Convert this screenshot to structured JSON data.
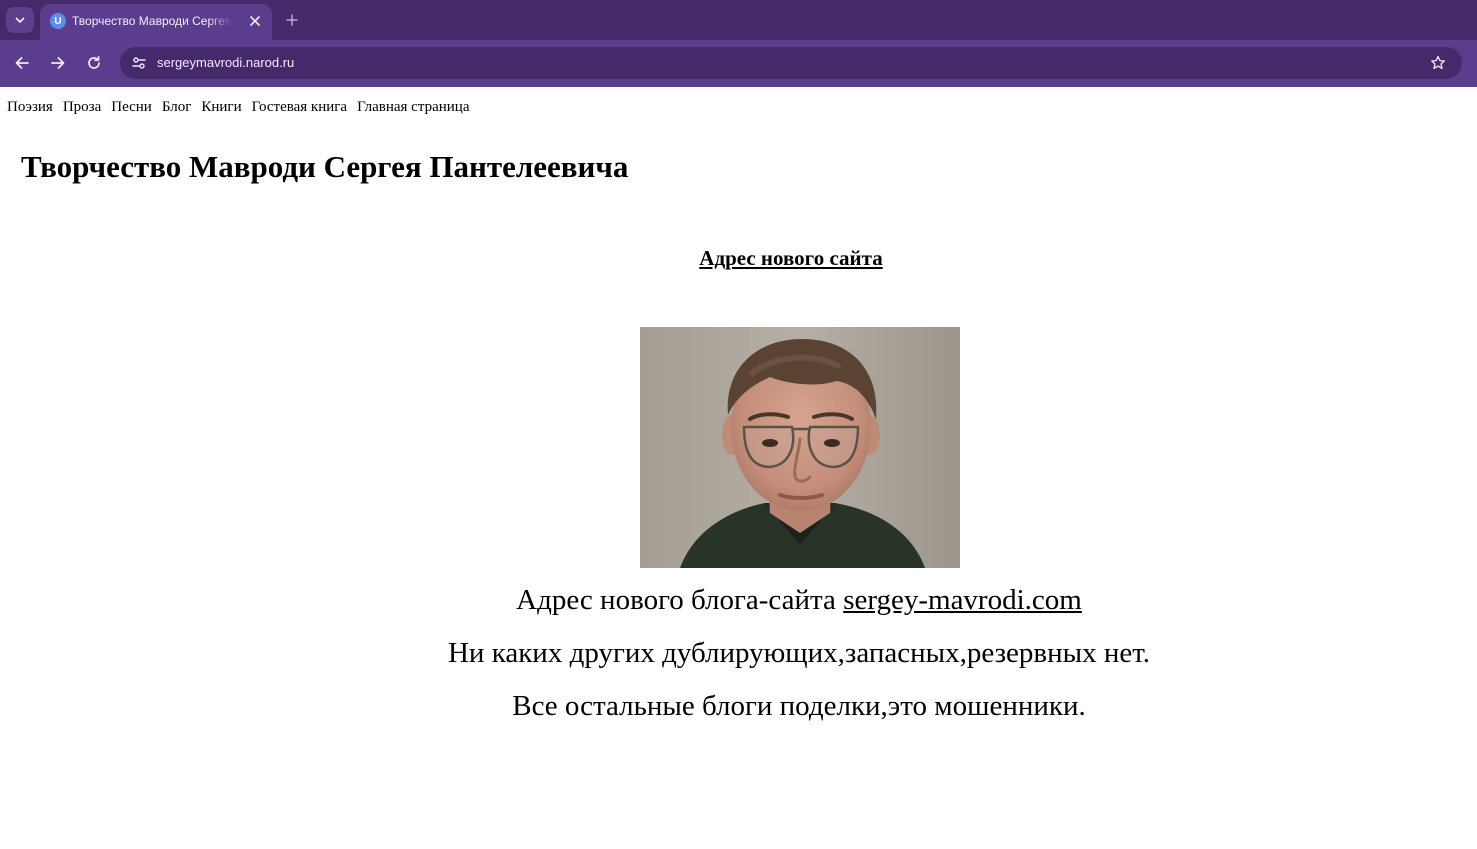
{
  "browser": {
    "tab_title": "Творчество Мавроди Сергея Пантелеевича",
    "favicon_letter": "U",
    "url": "sergeymavrodi.narod.ru",
    "colors": {
      "frame": "#452a6b",
      "toolbar": "#5b3d8e"
    }
  },
  "site_nav": {
    "items": [
      {
        "label": "Поэзия"
      },
      {
        "label": "Проза"
      },
      {
        "label": "Песни"
      },
      {
        "label": "Блог"
      },
      {
        "label": "Книги"
      },
      {
        "label": "Гостевая книга"
      },
      {
        "label": "Главная страница"
      }
    ]
  },
  "page": {
    "title": "Творчество Мавроди Сергея Пантелеевича",
    "new_site_heading": "Адрес нового сайта",
    "photo": "portrait-photo",
    "line1_prefix": "Адрес нового блога-сайта ",
    "line1_link": "sergey-mavrodi.com",
    "line2": "Ни каких других дублирующих,запасных,резервных нет.",
    "line3": "Все остальные блоги поделки,это мошенники."
  }
}
